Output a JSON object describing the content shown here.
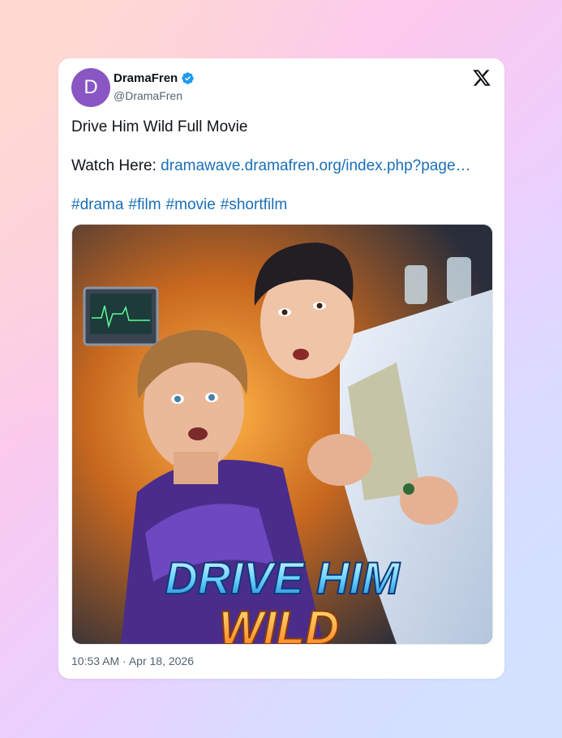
{
  "account": {
    "avatar_letter": "D",
    "avatar_color": "#8a56c4",
    "display_name": "DramaFren",
    "handle": "@DramaFren",
    "verified_color": "#1d9bf0"
  },
  "tweet": {
    "title_line": "Drive Him Wild Full Movie",
    "watch_label": "Watch Here:",
    "link_text": "dramawave.dramafren.org/index.php?page…",
    "hashtags": [
      "#drama",
      "#film",
      "#movie",
      "#shortfilm"
    ],
    "timestamp": "10:53 AM · Apr 18, 2026"
  },
  "media": {
    "poster_title_line1": "DRIVE HIM",
    "poster_title_line2": "WILD"
  },
  "colors": {
    "link": "#1a6fb8",
    "text": "#0f1419",
    "muted": "#536471"
  }
}
